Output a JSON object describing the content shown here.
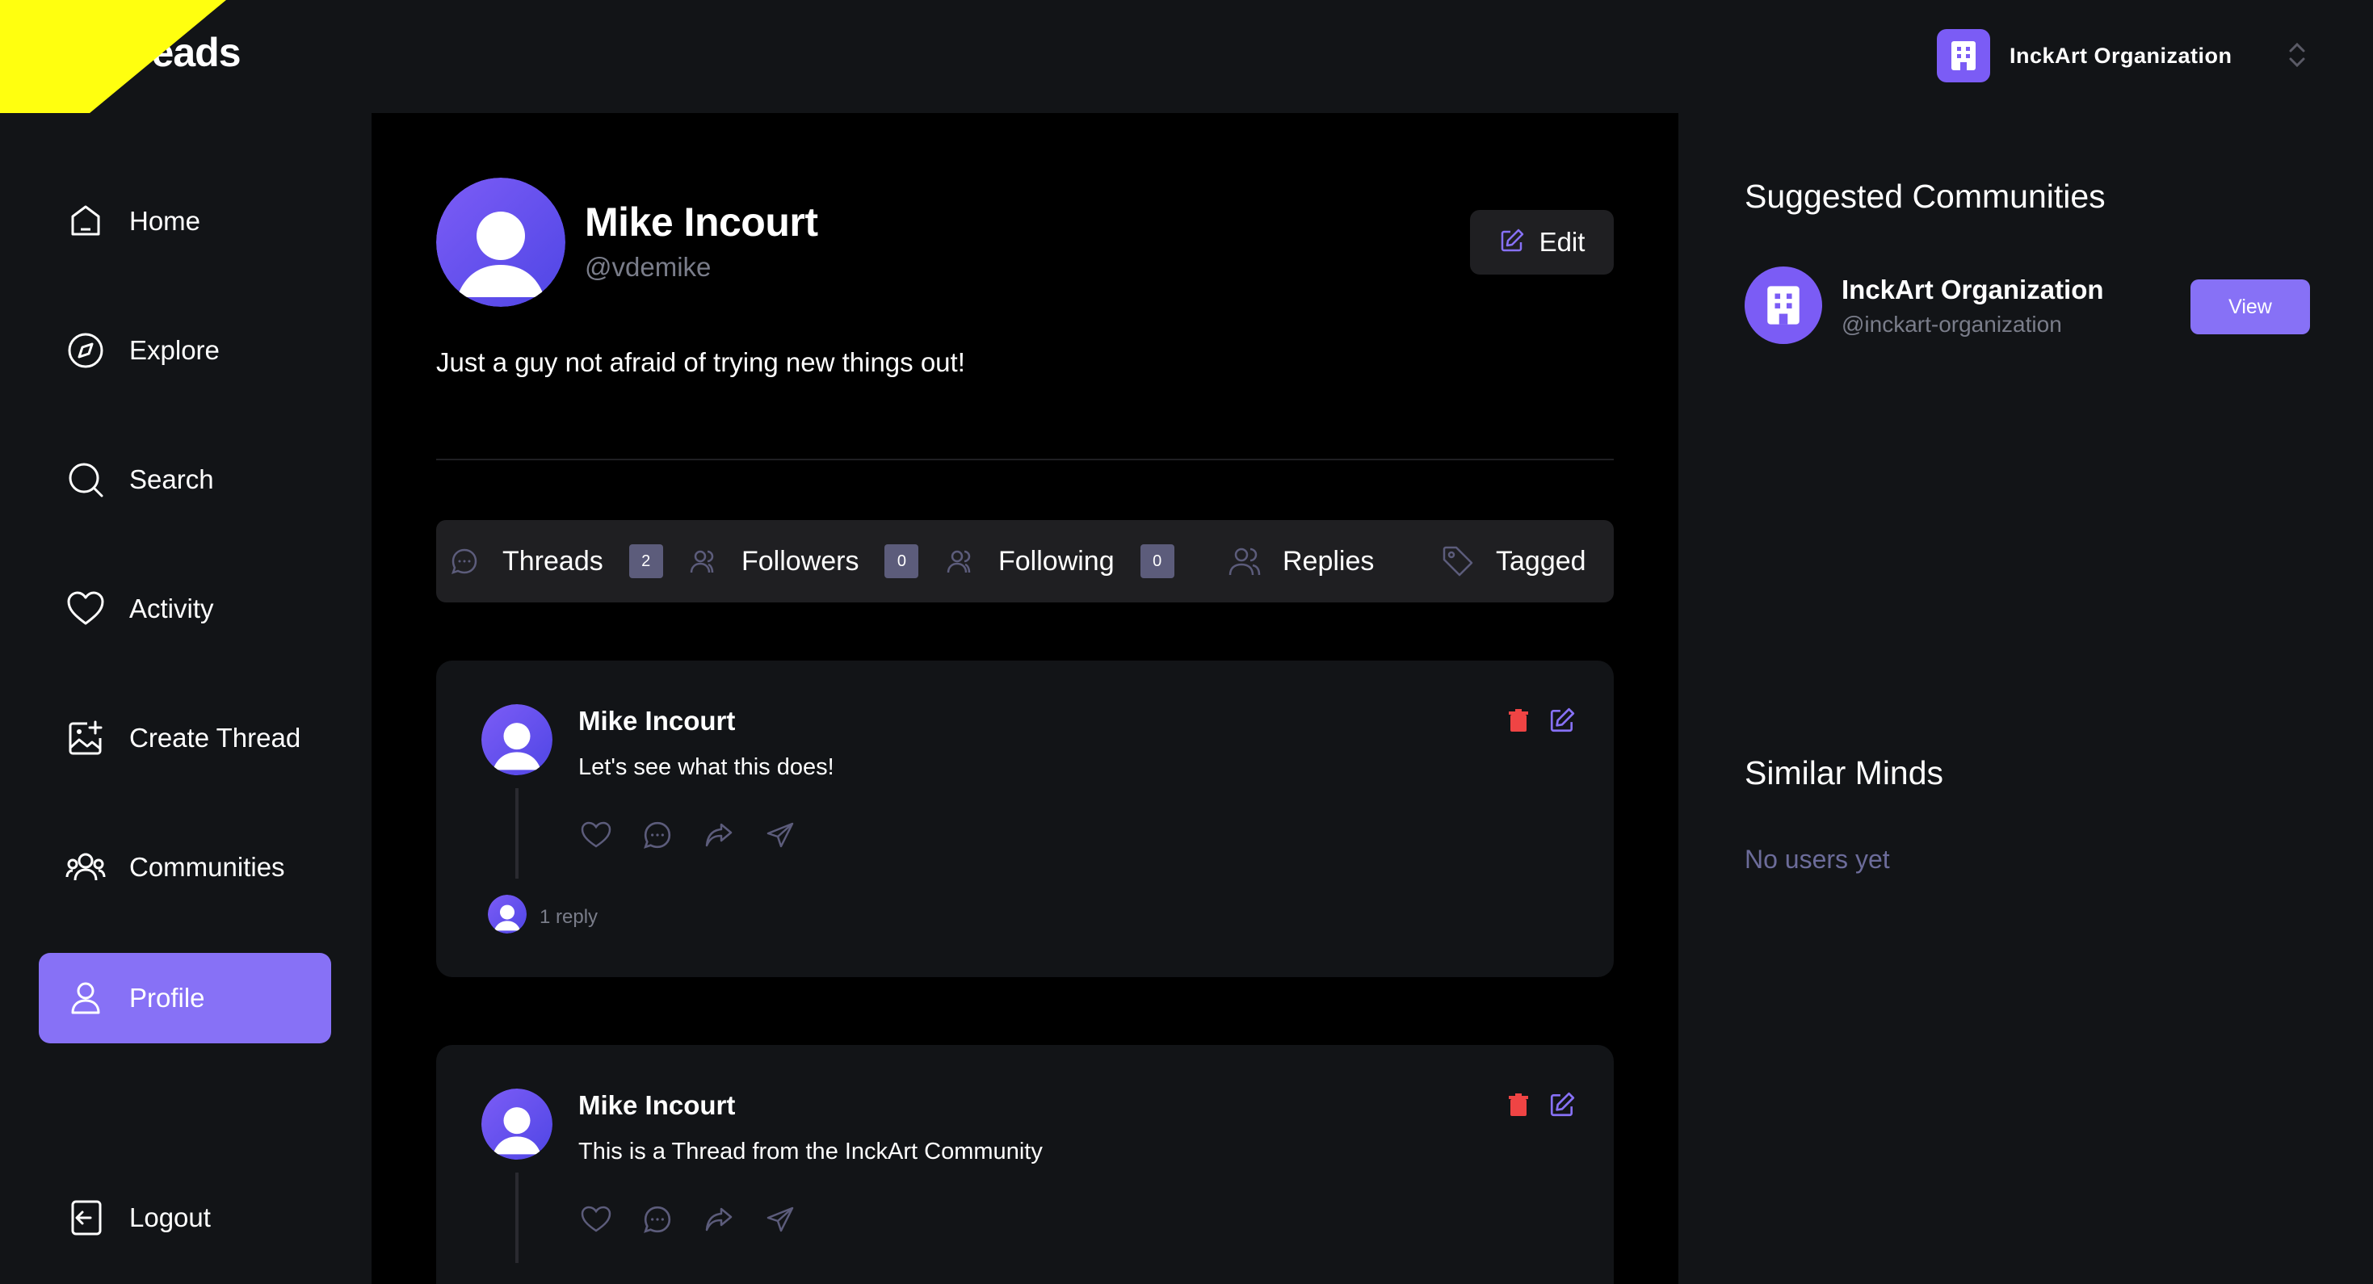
{
  "app": {
    "brand": "Threads"
  },
  "org_switcher": {
    "name": "InckArt Organization"
  },
  "sidebar": {
    "items": [
      {
        "label": "Home",
        "icon": "home-icon"
      },
      {
        "label": "Explore",
        "icon": "compass-icon"
      },
      {
        "label": "Search",
        "icon": "search-icon"
      },
      {
        "label": "Activity",
        "icon": "heart-icon"
      },
      {
        "label": "Create Thread",
        "icon": "image-plus-icon"
      },
      {
        "label": "Communities",
        "icon": "users-icon"
      },
      {
        "label": "Profile",
        "icon": "user-icon",
        "active": true
      }
    ],
    "logout": "Logout"
  },
  "profile": {
    "name": "Mike Incourt",
    "handle": "@vdemike",
    "edit_label": "Edit",
    "bio": "Just a guy not afraid of trying new things out!"
  },
  "tabs": [
    {
      "label": "Threads",
      "count": "2"
    },
    {
      "label": "Followers",
      "count": "0"
    },
    {
      "label": "Following",
      "count": "0"
    },
    {
      "label": "Replies"
    },
    {
      "label": "Tagged"
    }
  ],
  "threads": [
    {
      "author": "Mike Incourt",
      "text": "Let's see what this does!",
      "replies": "1 reply"
    },
    {
      "author": "Mike Incourt",
      "text": "This is a Thread from the InckArt Community"
    }
  ],
  "right": {
    "suggested_title": "Suggested Communities",
    "community": {
      "name": "InckArt Organization",
      "handle": "@inckart-organization",
      "view_label": "View"
    },
    "similar_title": "Similar Minds",
    "similar_empty": "No users yet"
  },
  "colors": {
    "accent": "#8771f6",
    "danger": "#ef4444",
    "muted": "#7a7d8a"
  }
}
